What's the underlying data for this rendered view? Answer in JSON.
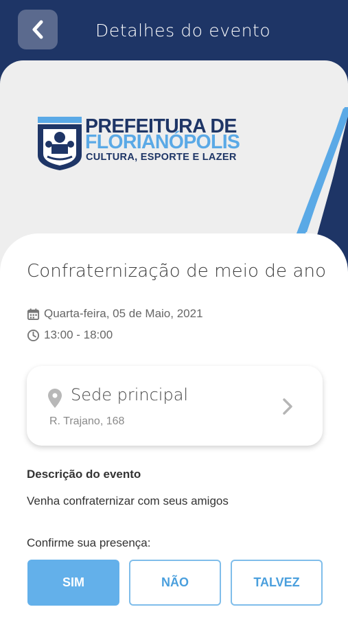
{
  "header": {
    "title": "Detalhes do evento",
    "back_icon": "chevron-left-icon"
  },
  "banner": {
    "logo_line1": "PREFEITURA DE",
    "logo_line2": "FLORIANÓPOLIS",
    "logo_line3": "CULTURA, ESPORTE E LAZER",
    "colors": {
      "navy": "#1e3566",
      "light_blue": "#5aa9e6"
    }
  },
  "event": {
    "title": "Confraternização de meio de ano",
    "date": "Quarta-feira, 05 de Maio, 2021",
    "time": "13:00 - 18:00",
    "date_icon": "calendar-icon",
    "time_icon": "clock-icon"
  },
  "location": {
    "name": "Sede principal",
    "address": "R. Trajano, 168",
    "pin_icon": "map-pin-icon",
    "chevron_icon": "chevron-right-icon"
  },
  "description": {
    "label": "Descrição do evento",
    "text": "Venha confraternizar com seus amigos"
  },
  "rsvp": {
    "label": "Confirme sua presença:",
    "options": [
      "SIM",
      "NÃO",
      "TALVEZ"
    ],
    "selected": "SIM",
    "accent": "#63b0ea"
  }
}
